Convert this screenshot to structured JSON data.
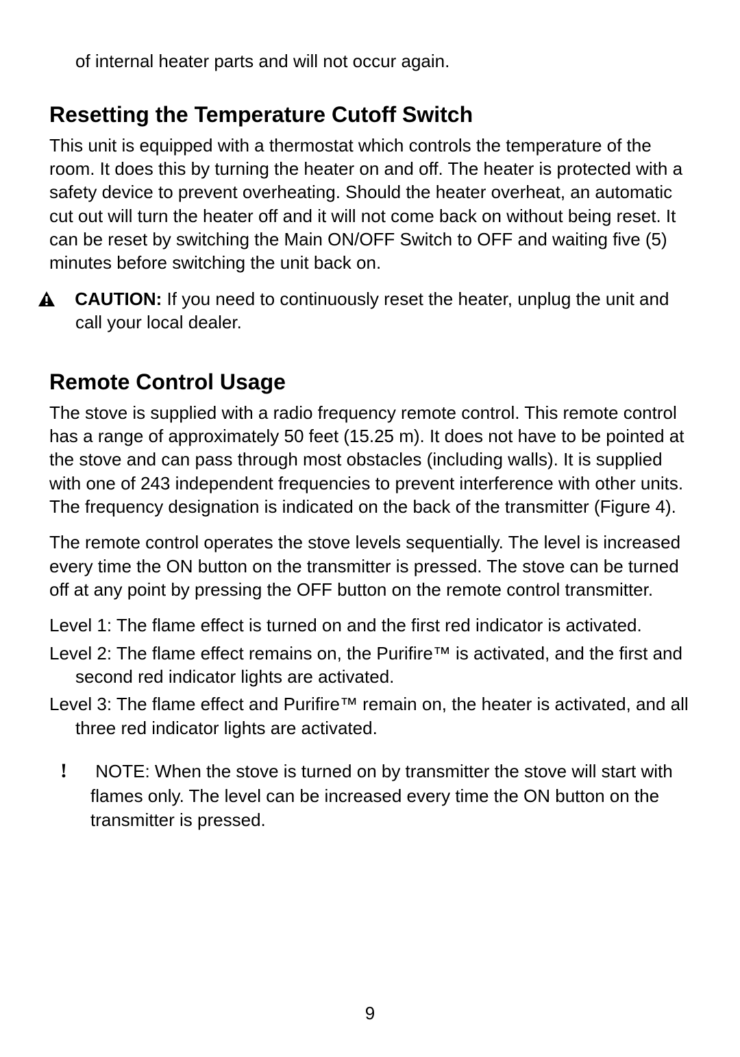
{
  "continued_line": "of internal heater parts and will not occur again.",
  "section1": {
    "heading": "Resetting the Temperature Cutoff Switch",
    "para": "This unit is equipped with a thermostat which controls the temperature of the room.  It does this by turning the heater on and off.  The heater is protected with a safety device to prevent overheating.  Should the heater overheat, an automatic cut out will turn the heater off and it will not come back on without being reset.  It can be reset by switching the Main ON/OFF Switch to OFF and waiting five (5) minutes before switching the unit back on.",
    "caution_label": "CAUTION:",
    "caution_text": "  If you need to continuously reset the heater, unplug the unit and call your local dealer."
  },
  "section2": {
    "heading": "Remote Control Usage",
    "para1": "The stove is supplied with a radio frequency remote control.  This remote control has a range of approximately 50 feet (15.25 m).  It does not have to be pointed at the stove and can pass through most obstacles (including walls).  It is supplied with one of 243 independent frequencies to prevent interference with other units.  The frequency designation is indicated on the back of the transmitter (Figure 4).",
    "para2": "The remote control operates the stove levels sequentially.  The level is increased every time the ON button on the transmitter is pressed.  The stove can be turned off at any point by pressing the OFF button on the remote control transmitter.",
    "level1": "Level 1:  The flame effect is turned on and the first red indicator is activated.",
    "level2": "Level 2:  The flame effect remains on, the Purifire™  is activated, and the first and second red indicator lights are activated.",
    "level3": "Level 3:  The flame effect and Purifire™ remain on, the heater is activated, and all three red indicator lights are activated.",
    "note_label": "NOTE:",
    "note_text": "  When the stove is turned on by transmitter the stove will start with flames only.  The level can be increased every time the ON button on the transmitter is pressed."
  },
  "page_number": "9"
}
